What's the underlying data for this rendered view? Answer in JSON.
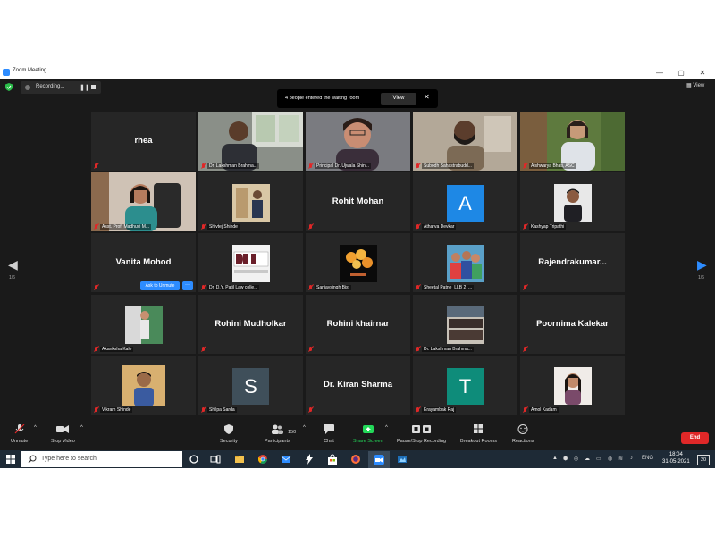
{
  "window": {
    "title": "Zoom Meeting",
    "minimize": "—",
    "maximize": "▢",
    "close": "✕"
  },
  "recording": {
    "label": "Recording...",
    "pause_glyph": "❚❚"
  },
  "waiting_room": {
    "message": "4 people entered the waiting room",
    "view_label": "View",
    "close_glyph": "✕"
  },
  "view_button": {
    "label": "View"
  },
  "pagination": {
    "left": "1/6",
    "right": "1/6"
  },
  "tiles": {
    "t1": {
      "name": "rhea"
    },
    "t2": {
      "name": "Dr. Lakshman Brahma..."
    },
    "t3": {
      "name": "Principal Dr. Ujwala Shin..."
    },
    "t4": {
      "name": "Subodh Sahastrabudd..."
    },
    "t5": {
      "name": "Aishwarya Bhati, ASC"
    },
    "t6": {
      "name": "Asst. Prof. Madhuvi M..."
    },
    "t7": {
      "name": "Shivtej Shinde"
    },
    "t8": {
      "name": "Rohit Mohan"
    },
    "t9": {
      "name": "Atharva Devkar",
      "initial": "A"
    },
    "t10": {
      "name": "Kashyap Tripathi"
    },
    "t11": {
      "name": "Vanita Mohod"
    },
    "t12": {
      "name": "Dr. D.Y. Patil Law colle..."
    },
    "t13": {
      "name": "Sanjaysingh Bist"
    },
    "t14": {
      "name": "Sheetal Patne_LLB 2_..."
    },
    "t15": {
      "name": "Rajendrakumar..."
    },
    "t16": {
      "name": "Akanksha Kale"
    },
    "t17": {
      "name": "Rohini Mudholkar"
    },
    "t18": {
      "name": "Rohini khairnar"
    },
    "t19": {
      "name": "Dr. Lakshman Brahma..."
    },
    "t20": {
      "name": "Poornima Kalekar"
    },
    "t21": {
      "name": "Vikram Shinde"
    },
    "t22": {
      "name": "Shilpa Sarda",
      "initial": "S"
    },
    "t23": {
      "name": "Dr. Kiran Sharma"
    },
    "t24": {
      "name": "Erayambak Raj",
      "initial": "T"
    },
    "t25": {
      "name": "Amol Kadam"
    }
  },
  "ask_to_unmute": {
    "label": "Ask to Unmute",
    "more": "···"
  },
  "toolbar": {
    "unmute": "Unmute",
    "stop_video": "Stop Video",
    "security": "Security",
    "participants": "Participants",
    "participant_count": "150",
    "chat": "Chat",
    "share_screen": "Share Screen",
    "pause_stop_recording": "Pause/Stop Recording",
    "breakout_rooms": "Breakout Rooms",
    "reactions": "Reactions",
    "end": "End",
    "caret": "^"
  },
  "taskbar": {
    "search_placeholder": "Type here to search",
    "lang": "ENG",
    "time": "18:04",
    "date": "31-05-2021",
    "notif_count": "20"
  },
  "colors": {
    "accent": "#2D8CFF",
    "end_red": "#E02828",
    "share_green": "#23D959",
    "active_speaker": "#E3E34A",
    "avatar_blue": "#1E88E5",
    "avatar_teal": "#0E8C7A",
    "avatar_slate": "#3F4F5A"
  }
}
